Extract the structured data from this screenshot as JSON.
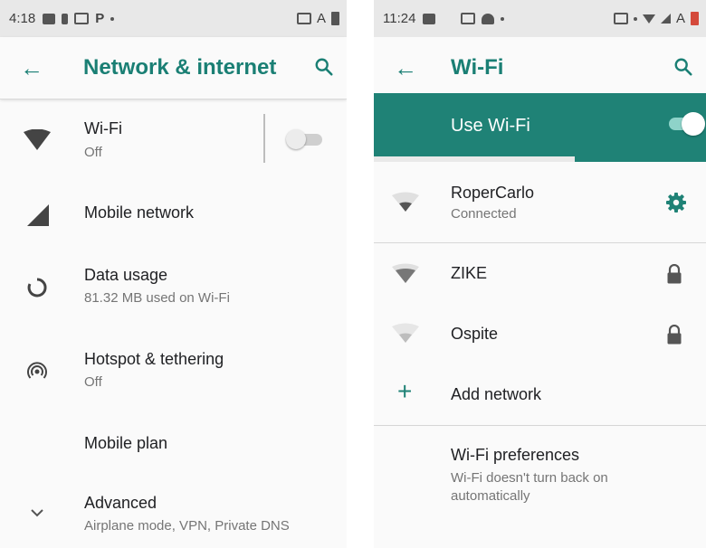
{
  "left": {
    "status": {
      "time": "4:18",
      "right_text": "A"
    },
    "title": "Network & internet",
    "items": [
      {
        "title": "Wi-Fi",
        "subtitle": "Off"
      },
      {
        "title": "Mobile network"
      },
      {
        "title": "Data usage",
        "subtitle": "81.32 MB used on Wi-Fi"
      },
      {
        "title": "Hotspot & tethering",
        "subtitle": "Off"
      },
      {
        "title": "Mobile plan"
      },
      {
        "title": "Advanced",
        "subtitle": "Airplane mode, VPN, Private DNS"
      }
    ],
    "wifi_toggle": "off"
  },
  "right": {
    "status": {
      "time": "11:24",
      "right_text": "A"
    },
    "title": "Wi-Fi",
    "use_wifi": {
      "label": "Use Wi-Fi",
      "state": "on"
    },
    "networks": [
      {
        "name": "RoperCarlo",
        "status": "Connected",
        "icon": "gear-icon"
      },
      {
        "name": "ZIKE",
        "icon": "lock-icon"
      },
      {
        "name": "Ospite",
        "icon": "lock-icon"
      }
    ],
    "add_network": "Add network",
    "preferences": {
      "title": "Wi-Fi preferences",
      "subtitle": "Wi-Fi doesn't turn back on automatically"
    }
  },
  "colors": {
    "accent": "#1f8276",
    "accent_text": "#1a7f74",
    "toggle_on_track": "#8ed3c9"
  }
}
